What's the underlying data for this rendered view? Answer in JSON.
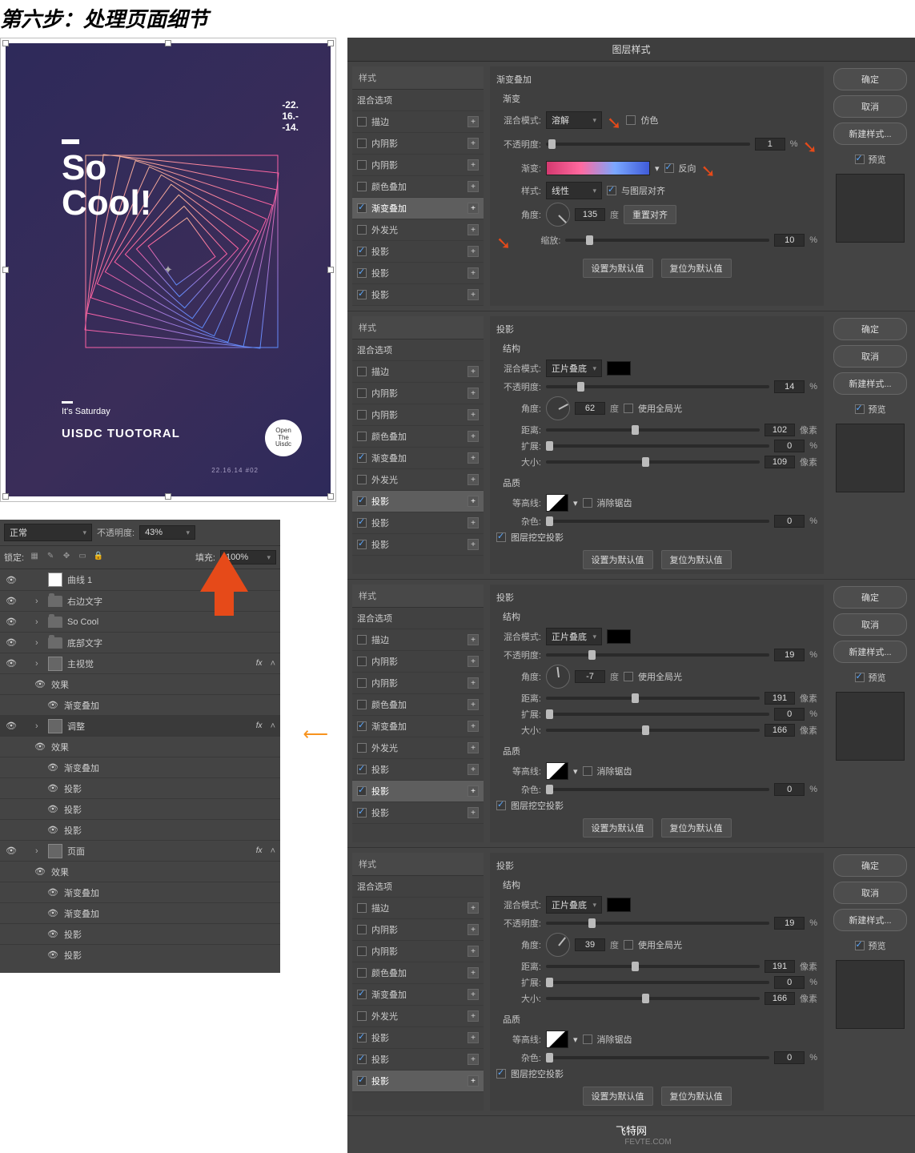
{
  "title": "第六步：处理页面细节",
  "poster": {
    "dates": "-22.\n16.-\n-14.",
    "so_line1": "So",
    "so_line2": "Cool!",
    "sat": "It's Saturday",
    "uisdc": "UISDC TUOTORAL",
    "badge": "Open\nThe\nUisdc",
    "meta": "22.16.14  #02"
  },
  "layers_panel": {
    "blend_label": "正常",
    "opacity_label": "不透明度:",
    "opacity_value": "43%",
    "lock_label": "锁定:",
    "fill_label": "填充:",
    "fill_value": "100%",
    "items": [
      {
        "name": "曲线 1",
        "thumb": "w"
      },
      {
        "name": "右边文字",
        "folder": true
      },
      {
        "name": "So Cool",
        "folder": true
      },
      {
        "name": "底部文字",
        "folder": true
      },
      {
        "name": "主视觉",
        "fx": true
      },
      {
        "name": "调整",
        "fx": true,
        "sel": true
      },
      {
        "name": "页面",
        "fx": true
      }
    ],
    "fx_label": "效果",
    "fx_gradient": "渐变叠加",
    "fx_shadow": "投影"
  },
  "dialog_title": "图层样式",
  "style_header": "样式",
  "blend_options": "混合选项",
  "style_items": [
    "描边",
    "内阴影",
    "内阴影",
    "颜色叠加",
    "渐变叠加",
    "外发光",
    "投影",
    "投影",
    "投影"
  ],
  "buttons": {
    "ok": "确定",
    "cancel": "取消",
    "new": "新建样式...",
    "preview": "预览",
    "default1": "设置为默认值",
    "default2": "复位为默认值",
    "reset_align": "重置对齐"
  },
  "gradient": {
    "header": "渐变叠加",
    "sub": "渐变",
    "blend_mode_l": "混合模式:",
    "blend_mode_v": "溶解",
    "dither": "仿色",
    "opacity_l": "不透明度:",
    "opacity_v": "1",
    "opacity_u": "%",
    "grad_l": "渐变:",
    "reverse": "反向",
    "style_l": "样式:",
    "style_v": "线性",
    "align": "与图层对齐",
    "angle_l": "角度:",
    "angle_v": "135",
    "angle_u": "度",
    "scale_l": "缩放:",
    "scale_v": "10",
    "scale_u": "%"
  },
  "shadow_panels": [
    {
      "header": "投影",
      "structure": "结构",
      "blend_mode_l": "混合模式:",
      "blend_mode_v": "正片叠底",
      "opacity_l": "不透明度:",
      "opacity_v": "14",
      "opacity_u": "%",
      "angle_l": "角度:",
      "angle_v": "62",
      "angle_u": "度",
      "global": "使用全局光",
      "distance_l": "距离:",
      "distance_v": "102",
      "px": "像素",
      "spread_l": "扩展:",
      "spread_v": "0",
      "spread_u": "%",
      "size_l": "大小:",
      "size_v": "109",
      "quality": "品质",
      "contour_l": "等高线:",
      "anti": "消除锯齿",
      "noise_l": "杂色:",
      "noise_v": "0",
      "knockout": "图层挖空投影"
    },
    {
      "header": "投影",
      "structure": "结构",
      "blend_mode_l": "混合模式:",
      "blend_mode_v": "正片叠底",
      "opacity_l": "不透明度:",
      "opacity_v": "19",
      "opacity_u": "%",
      "angle_l": "角度:",
      "angle_v": "-7",
      "angle_u": "度",
      "global": "使用全局光",
      "distance_l": "距离:",
      "distance_v": "191",
      "px": "像素",
      "spread_l": "扩展:",
      "spread_v": "0",
      "spread_u": "%",
      "size_l": "大小:",
      "size_v": "166",
      "quality": "品质",
      "contour_l": "等高线:",
      "anti": "消除锯齿",
      "noise_l": "杂色:",
      "noise_v": "0",
      "knockout": "图层挖空投影"
    },
    {
      "header": "投影",
      "structure": "结构",
      "blend_mode_l": "混合模式:",
      "blend_mode_v": "正片叠底",
      "opacity_l": "不透明度:",
      "opacity_v": "19",
      "opacity_u": "%",
      "angle_l": "角度:",
      "angle_v": "39",
      "angle_u": "度",
      "global": "使用全局光",
      "distance_l": "距离:",
      "distance_v": "191",
      "px": "像素",
      "spread_l": "扩展:",
      "spread_v": "0",
      "spread_u": "%",
      "size_l": "大小:",
      "size_v": "166",
      "quality": "品质",
      "contour_l": "等高线:",
      "anti": "消除锯齿",
      "noise_l": "杂色:",
      "noise_v": "0",
      "knockout": "图层挖空投影"
    }
  ],
  "style_list_checked": {
    "0": [
      4,
      6,
      7,
      8
    ],
    "1": [
      4,
      6,
      7,
      8
    ],
    "2": [
      4,
      6,
      7,
      8
    ],
    "3": [
      4,
      6,
      7,
      8
    ]
  },
  "style_list_active": {
    "0": 4,
    "1": 6,
    "2": 7,
    "3": 8
  },
  "footer": {
    "l1": "飞特网",
    "l2": "FEVTE.COM"
  }
}
